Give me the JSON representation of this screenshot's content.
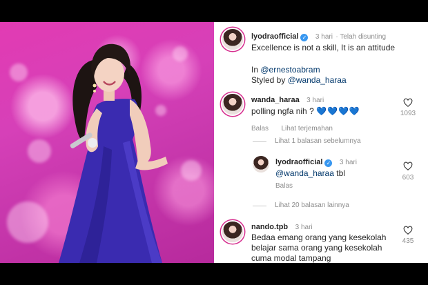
{
  "post": {
    "author": "lyodraofficial",
    "time": "3 hari",
    "edited": "· Telah disunting",
    "caption": "Excellence is not a skill, It is an attitude",
    "in_label": "In",
    "in_handle": "@ernestoabram",
    "styled_label": "Styled by",
    "styled_handle": "@wanda_haraa"
  },
  "comments": [
    {
      "user": "wanda_haraa",
      "time": "3 hari",
      "text": "polling ngfa nih ?",
      "emoji": "💙💙💙💙",
      "reply_label": "Balas",
      "translate_label": "Lihat terjemahan",
      "likes": "1093",
      "view_prev": "Lihat 1 balasan sebelumnya",
      "reply": {
        "user": "lyodraofficial",
        "time": "3 hari",
        "mention": "@wanda_haraa",
        "text": "tbl",
        "reply_label": "Balas",
        "likes": "603"
      },
      "view_more": "Lihat 20 balasan lainnya"
    },
    {
      "user": "nando.tpb",
      "time": "3 hari",
      "text_lines": [
        "Bedaa emang orang yang kesekolah",
        "belajar sama orang yang kesekolah",
        "cuma modal tampang"
      ],
      "likes": "435"
    }
  ],
  "colors": {
    "accent": "#3897f0",
    "link": "#00376b",
    "muted": "#8e8e8e",
    "dress": "#3a2bb0",
    "background": "#d640b8"
  }
}
